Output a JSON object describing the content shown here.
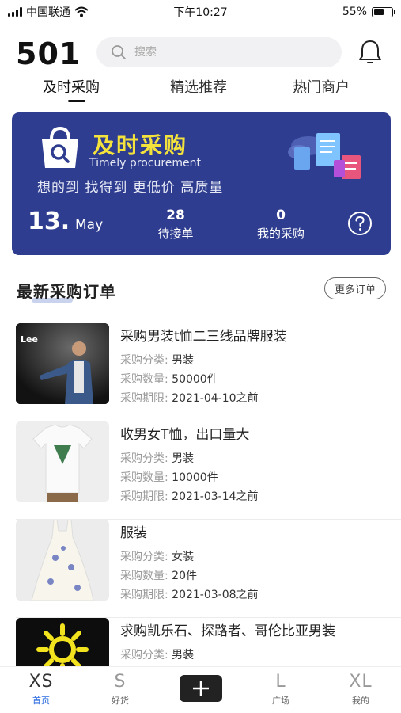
{
  "status_bar": {
    "carrier": "中国联通",
    "time": "下午10:27",
    "battery": "55%",
    "battery_level": 0.55
  },
  "header": {
    "logo": "501",
    "search_placeholder": "搜索",
    "icons": {
      "search": "search-icon",
      "notification": "bell-icon"
    }
  },
  "tabs": [
    {
      "label": "及时采购",
      "active": true
    },
    {
      "label": "精选推荐",
      "active": false
    },
    {
      "label": "热门商户",
      "active": false
    }
  ],
  "banner": {
    "title": "及时采购",
    "subtitle_en": "Timely procurement",
    "slogan": "想的到 找得到 更低价 高质量",
    "date_day": "13.",
    "date_month": "May",
    "stats": [
      {
        "value": "28",
        "label": "待接单"
      },
      {
        "value": "0",
        "label": "我的采购"
      }
    ],
    "colors": {
      "background": "#2e3d8f",
      "title": "#f4e23c"
    }
  },
  "section": {
    "title": "最新采购订单",
    "more_label": "更多订单"
  },
  "orders": [
    {
      "title": "采购男装t恤二三线品牌服装",
      "category_label": "采购分类: ",
      "category": "男装",
      "quantity_label": "采购数量: ",
      "quantity": "50000件",
      "deadline_label": "采购期限: ",
      "deadline": "2021-04-10之前",
      "thumb_text": "Lee"
    },
    {
      "title": "收男女T恤，出口量大",
      "category_label": "采购分类: ",
      "category": "男装",
      "quantity_label": "采购数量: ",
      "quantity": "10000件",
      "deadline_label": "采购期限: ",
      "deadline": "2021-03-14之前"
    },
    {
      "title": "服装",
      "category_label": "采购分类: ",
      "category": "女装",
      "quantity_label": "采购数量: ",
      "quantity": "20件",
      "deadline_label": "采购期限: ",
      "deadline": "2021-03-08之前"
    },
    {
      "title": "求购凯乐石、探路者、哥伦比亚男装",
      "category_label": "采购分类: ",
      "category": "男装"
    }
  ],
  "bottom_nav": [
    {
      "size": "XS",
      "label": "首页",
      "active": true
    },
    {
      "size": "S",
      "label": "好货",
      "active": false
    },
    {
      "size": "L",
      "label": "广场",
      "active": false
    },
    {
      "size": "XL",
      "label": "我的",
      "active": false
    }
  ]
}
